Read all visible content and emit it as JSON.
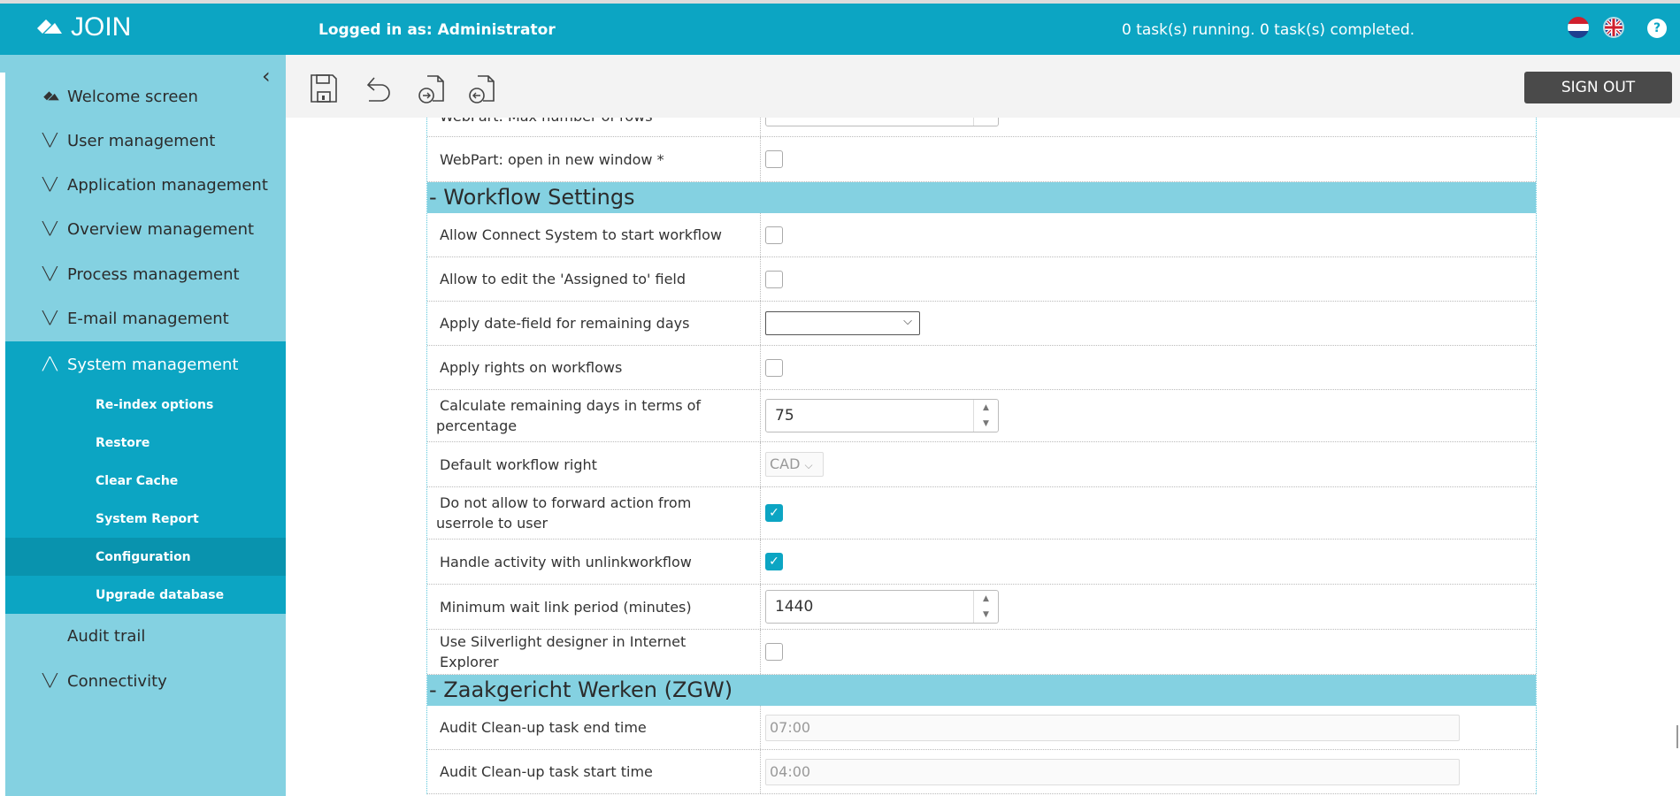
{
  "header": {
    "app_name": "JOIN",
    "logged_in": "Logged in as: Administrator",
    "tasks": "0 task(s) running. 0 task(s) completed.",
    "help": "?",
    "languages": [
      "Dutch",
      "English"
    ]
  },
  "colors": {
    "brand": "#0ca5c3",
    "sidebar": "#84d1e1",
    "active": "#0993ae"
  },
  "sidebar": {
    "items": [
      {
        "label": "Welcome screen",
        "icon": "join-logo-icon"
      },
      {
        "label": "User management",
        "icon": "chevron-down-icon"
      },
      {
        "label": "Application management",
        "icon": "chevron-down-icon"
      },
      {
        "label": "Overview management",
        "icon": "chevron-down-icon"
      },
      {
        "label": "Process management",
        "icon": "chevron-down-icon"
      },
      {
        "label": "E-mail management",
        "icon": "chevron-down-icon"
      },
      {
        "label": "System management",
        "icon": "chevron-up-icon"
      },
      {
        "label": "Audit trail"
      },
      {
        "label": "Connectivity",
        "icon": "chevron-down-icon"
      }
    ],
    "sub_items": [
      "Re-index options",
      "Restore",
      "Clear Cache",
      "System Report",
      "Configuration",
      "Upgrade database"
    ],
    "active_sub": "Configuration"
  },
  "toolbar": {
    "sign_out": "SIGN OUT",
    "icons": [
      "save-icon",
      "undo-icon",
      "export-icon",
      "import-icon"
    ]
  },
  "settings": {
    "clipped_row": {
      "label": "WebPart: Max number of rows",
      "value": ""
    },
    "webpart_new_window": {
      "label": "WebPart: open in new window *",
      "checked": false
    },
    "workflow_title": "- Workflow Settings",
    "workflow": [
      {
        "label": "Allow Connect System to start workflow",
        "type": "checkbox",
        "checked": false
      },
      {
        "label": "Allow to edit the 'Assigned to' field",
        "type": "checkbox",
        "checked": false
      },
      {
        "label": "Apply date-field for remaining days",
        "type": "select",
        "value": ""
      },
      {
        "label": "Apply rights on workflows",
        "type": "checkbox",
        "checked": false
      },
      {
        "label": "Calculate remaining days in terms of percentage",
        "type": "number",
        "value": "75"
      },
      {
        "label": "Default workflow right",
        "type": "select-disabled",
        "value": "CAD"
      },
      {
        "label": "Do not allow to forward action from userrole to user",
        "type": "checkbox",
        "checked": true
      },
      {
        "label": "Handle activity with unlinkworkflow",
        "type": "checkbox",
        "checked": true
      },
      {
        "label": "Minimum wait link period (minutes)",
        "type": "number",
        "value": "1440"
      },
      {
        "label": "Use Silverlight designer in Internet Explorer",
        "type": "checkbox",
        "checked": false
      }
    ],
    "zgw_title": "- Zaakgericht Werken (ZGW)",
    "zgw": [
      {
        "label": "Audit Clean-up task end time",
        "value": "07:00"
      },
      {
        "label": "Audit Clean-up task start time",
        "value": "04:00"
      }
    ]
  }
}
